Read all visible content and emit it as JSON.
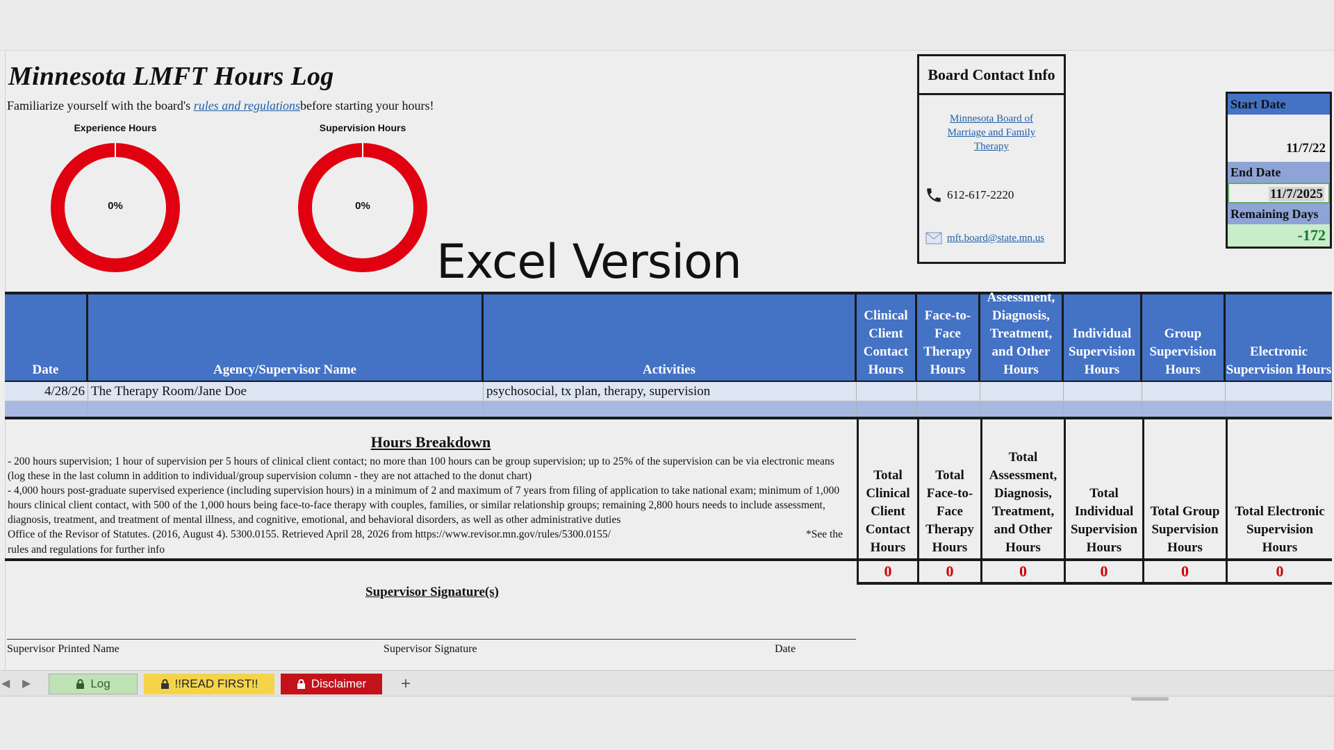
{
  "title": "Minnesota LMFT Hours Log",
  "intro": {
    "before": "Familiarize yourself with the board's ",
    "link": "rules and regulations",
    "after": "before starting your hours!"
  },
  "charts": {
    "experience": {
      "title": "Experience Hours",
      "percent_label": "0%"
    },
    "supervision": {
      "title": "Supervision Hours",
      "percent_label": "0%"
    }
  },
  "chart_data": [
    {
      "type": "pie",
      "title": "Experience Hours",
      "values": [
        0,
        100
      ],
      "display": "0%",
      "colors": [
        "#4472c4",
        "#e0000f"
      ]
    },
    {
      "type": "pie",
      "title": "Supervision Hours",
      "values": [
        0,
        100
      ],
      "display": "0%",
      "colors": [
        "#4472c4",
        "#e0000f"
      ]
    }
  ],
  "banner": "Excel Version",
  "board": {
    "heading": "Board Contact Info",
    "link": "Minnesota Board of Marriage and Family Therapy",
    "phone": "612-617-2220",
    "email": "mft.board@state.mn.us"
  },
  "dates": {
    "start_label": "Start Date",
    "start_value": "11/7/22",
    "end_label": "End Date",
    "end_value": "11/7/2025",
    "remaining_label": "Remaining Days",
    "remaining_value": "-172"
  },
  "columns": {
    "date": "Date",
    "agency": "Agency/Supervisor Name",
    "activities": "Activities",
    "clinical": "Clinical Client Contact Hours",
    "face": "Face-to-Face Therapy Hours",
    "assessment": "Assessment, Diagnosis, Treatment, and Other Hours",
    "individual": "Individual Supervision Hours",
    "group": "Group Supervision Hours",
    "electronic": "Electronic Supervision Hours"
  },
  "rows": [
    {
      "date": "4/28/26",
      "agency": "The Therapy Room/Jane Doe",
      "activities": "psychosocial, tx plan, therapy, supervision"
    }
  ],
  "breakdown": {
    "title": "Hours Breakdown",
    "para1": "- 200 hours supervision; 1 hour of supervision per 5 hours of clinical client contact; no more than 100 hours can be group supervision; up to 25% of the supervision can be via electronic means (log these in the last column in addition to individual/group supervision column - they are not attached to the donut chart)",
    "para2": "- 4,000 hours post-graduate supervised experience (including supervision hours) in a minimum of 2 and maximum of 7 years from filing of application to take national exam; minimum of 1,000 hours clinical client contact, with 500 of the 1,000 hours being face-to-face therapy with couples, families, or similar relationship groups; remaining 2,800 hours needs to include assessment, diagnosis, treatment, and treatment of mental illness, and cognitive, emotional, and behavioral disorders, as well as other administrative duties",
    "citation": "Office of the Revisor of Statutes. (2016, August 4). 5300.0155. Retrieved April 28, 2026 from https://www.revisor.mn.gov/rules/5300.0155/",
    "see_also": "*See the",
    "citation_end": "rules and regulations for further info"
  },
  "totals": {
    "clinical": "Total Clinical Client Contact Hours",
    "face": "Total Face-to-Face Therapy Hours",
    "assessment": "Total Assessment, Diagnosis, Treatment, and Other Hours",
    "individual": "Total Individual Supervision Hours",
    "group": "Total Group Supervision Hours",
    "electronic": "Total Electronic Supervision Hours"
  },
  "total_values": {
    "clinical": "0",
    "face": "0",
    "assessment": "0",
    "individual": "0",
    "group": "0",
    "electronic": "0"
  },
  "signature": {
    "title": "Supervisor Signature(s)",
    "printed_name": "Supervisor Printed Name",
    "signature": "Supervisor Signature",
    "date": "Date"
  },
  "tabs": {
    "log": "Log",
    "read_first": "!!READ FIRST!!",
    "disclaimer": "Disclaimer",
    "add": "+"
  },
  "icons": [
    "phone-icon",
    "mail-icon",
    "lock-icon",
    "chevron-left-icon",
    "chevron-right-icon"
  ],
  "colors": {
    "header_blue": "#4472c4",
    "donut_red": "#e0000f",
    "total_red": "#d40000",
    "remaining_green": "#0e7a2e"
  }
}
